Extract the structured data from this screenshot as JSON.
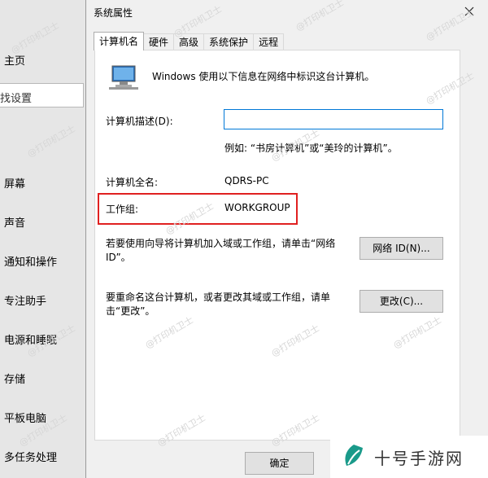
{
  "left_panel": {
    "items": [
      {
        "label": "主页"
      },
      {
        "label": "屏幕"
      },
      {
        "label": "声音"
      },
      {
        "label": "通知和操作"
      },
      {
        "label": "专注助手"
      },
      {
        "label": "电源和睡眠"
      },
      {
        "label": "存储"
      },
      {
        "label": "平板电脑"
      },
      {
        "label": "多任务处理"
      }
    ],
    "search_text": "找设置"
  },
  "dialog": {
    "title": "系统属性",
    "tabs": [
      {
        "label": "计算机名",
        "active": true
      },
      {
        "label": "硬件"
      },
      {
        "label": "高级"
      },
      {
        "label": "系统保护"
      },
      {
        "label": "远程"
      }
    ],
    "intro": "Windows 使用以下信息在网络中标识这台计算机。",
    "description_label": "计算机描述(D):",
    "description_value": "",
    "description_placeholder": "",
    "example": "例如: “书房计算机”或“美玲的计算机”。",
    "fullname_label": "计算机全名:",
    "fullname_value": "QDRS-PC",
    "workgroup_label": "工作组:",
    "workgroup_value": "WORKGROUP",
    "network_help": "若要使用向导将计算机加入域或工作组，请单击“网络 ID”。",
    "network_button": "网络 ID(N)...",
    "rename_help": "要重命名这台计算机，或者更改其域或工作组，请单击“更改”。",
    "change_button": "更改(C)...",
    "ok_button": "确定"
  },
  "watermark": "@打印机卫士",
  "brand": {
    "name": "十号手游网",
    "color": "#1a9a8a"
  }
}
